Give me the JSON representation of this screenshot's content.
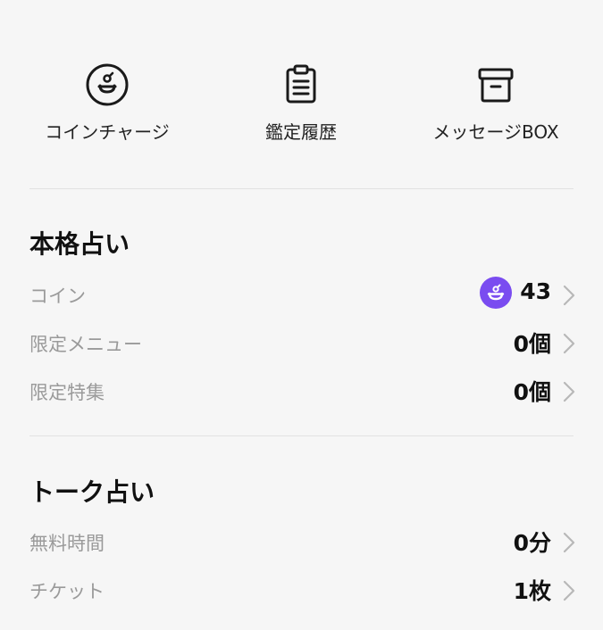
{
  "quick_actions": [
    {
      "label": "コインチャージ",
      "icon": "coin-icon"
    },
    {
      "label": "鑑定履歴",
      "icon": "clipboard-icon"
    },
    {
      "label": "メッセージBOX",
      "icon": "box-icon"
    }
  ],
  "honkaku": {
    "title": "本格占い",
    "rows": [
      {
        "label": "コイン",
        "value": "43",
        "icon": "coin-badge-icon"
      },
      {
        "label": "限定メニュー",
        "value": "0個"
      },
      {
        "label": "限定特集",
        "value": "0個"
      }
    ]
  },
  "talk": {
    "title": "トーク占い",
    "rows": [
      {
        "label": "無料時間",
        "value": "0分"
      },
      {
        "label": "チケット",
        "value": "1枚"
      }
    ]
  },
  "colors": {
    "background": "#f6f6f6",
    "accent": "#7a4cf0",
    "label_gray": "#9a9a9a",
    "divider": "#e2e2e2"
  }
}
